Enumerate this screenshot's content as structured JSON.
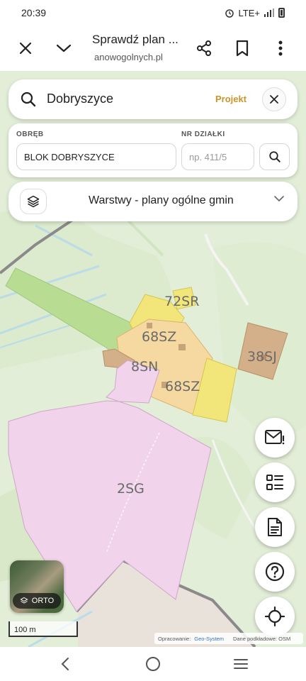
{
  "status_bar": {
    "time": "20:39",
    "network": "LTE+"
  },
  "browser": {
    "title": "Sprawdź plan ...",
    "url": "anowogolnych.pl"
  },
  "search": {
    "query": "Dobryszyce",
    "badge": "Projekt"
  },
  "parcel": {
    "obreb_label": "OBRĘB",
    "obreb_value": "BLOK DOBRYSZYCE",
    "nr_label": "NR DZIAŁKI",
    "nr_placeholder": "np. 411/5"
  },
  "layers": {
    "label": "Warstwy - plany ogólne gmin"
  },
  "zones": {
    "z1": "72SR",
    "z2": "68SZ",
    "z3": "38SJ",
    "z4": "8SN",
    "z5": "68SZ",
    "z6": "2SG"
  },
  "orto": {
    "label": "ORTO"
  },
  "scale": {
    "label": "100 m"
  },
  "attribution": {
    "prefix": "Opracowanie:",
    "provider": "Geo-System",
    "base": "Dane podkładowe: OSM"
  },
  "colors": {
    "yellow_zone": "#f2e57a",
    "orange_zone": "#f5d9a0",
    "brown_zone": "#d4b08a",
    "pink_zone": "#f1d4ec",
    "green_zone": "#b9dc93",
    "accent": "#c8962b"
  },
  "icons": {
    "mail": "mail-alert-icon",
    "legend": "legend-list-icon",
    "document": "document-icon",
    "help": "help-icon",
    "locate": "locate-icon"
  }
}
